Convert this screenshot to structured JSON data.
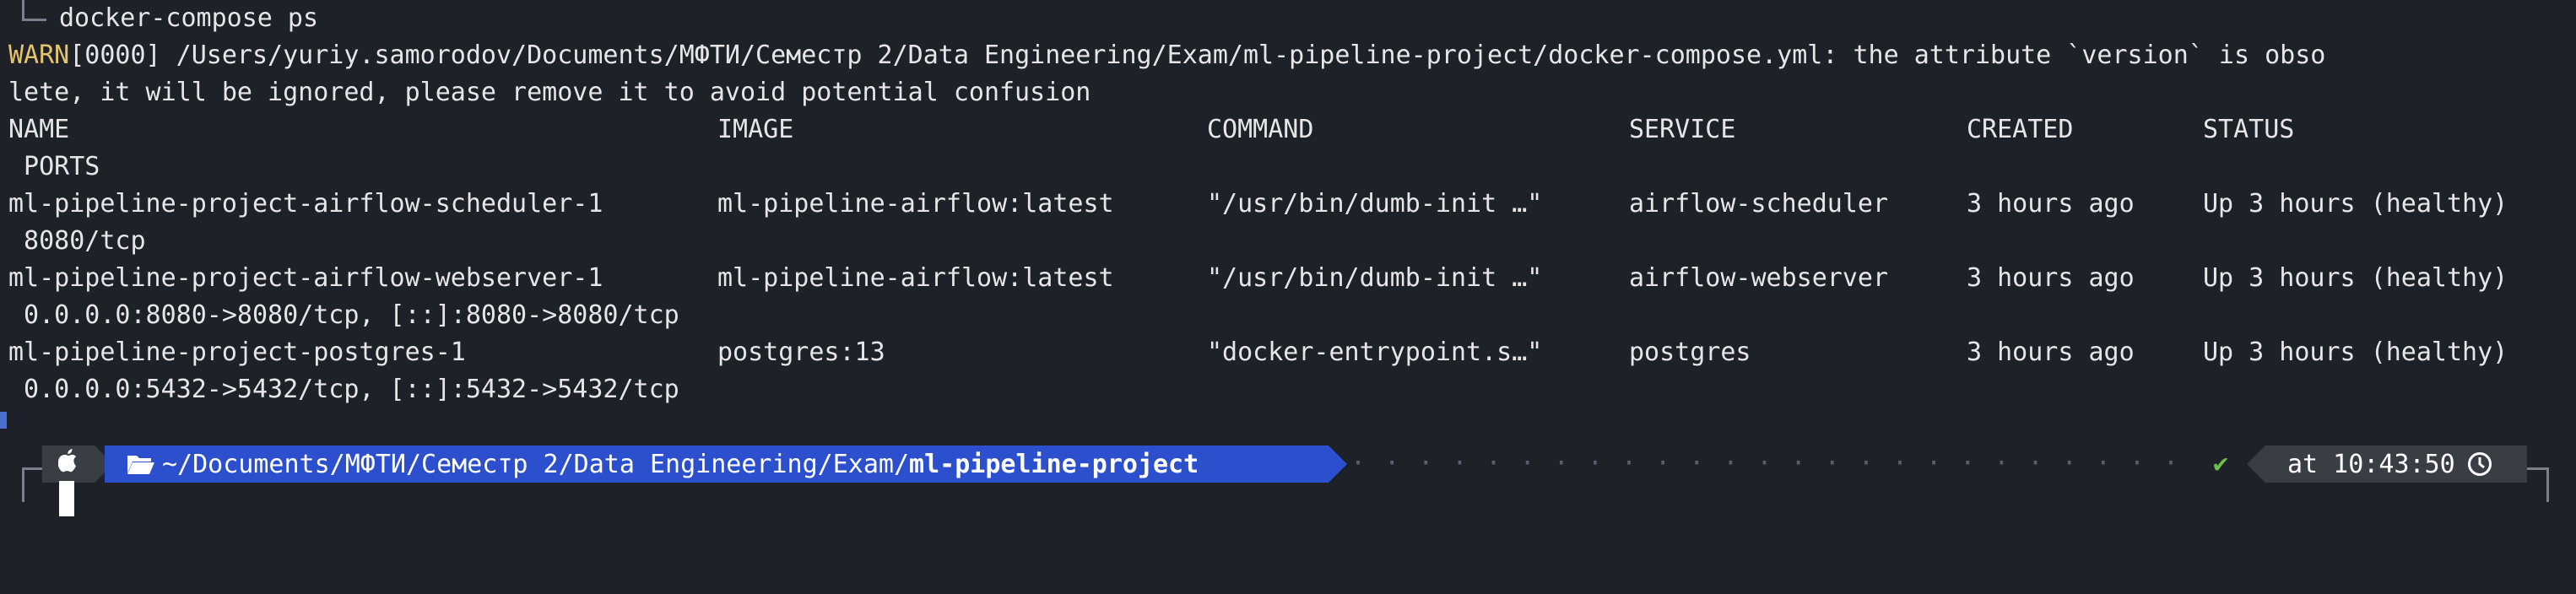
{
  "command_line": "docker-compose ps",
  "warn_prefix": "WARN",
  "warn_rest": "[0000] /Users/yuriy.samorodov/Documents/МФТИ/Семестр 2/Data Engineering/Exam/ml-pipeline-project/docker-compose.yml: the attribute `version` is obso",
  "warn_cont": "lete, it will be ignored, please remove it to avoid potential confusion",
  "headers": {
    "name": "NAME",
    "image": "IMAGE",
    "command": "COMMAND",
    "service": "SERVICE",
    "created": "CREATED",
    "status": "STATUS",
    "ports": " PORTS"
  },
  "rows": [
    {
      "name": "ml-pipeline-project-airflow-scheduler-1",
      "image": "ml-pipeline-airflow:latest",
      "command": "\"/usr/bin/dumb-init …\"",
      "service": "airflow-scheduler",
      "created": "3 hours ago",
      "status": "Up 3 hours (healthy)",
      "ports": " 8080/tcp"
    },
    {
      "name": "ml-pipeline-project-airflow-webserver-1",
      "image": "ml-pipeline-airflow:latest",
      "command": "\"/usr/bin/dumb-init …\"",
      "service": "airflow-webserver",
      "created": "3 hours ago",
      "status": "Up 3 hours (healthy)",
      "ports": " 0.0.0.0:8080->8080/tcp, [::]:8080->8080/tcp"
    },
    {
      "name": "ml-pipeline-project-postgres-1",
      "image": "postgres:13",
      "command": "\"docker-entrypoint.s…\"",
      "service": "postgres",
      "created": "3 hours ago",
      "status": "Up 3 hours (healthy)",
      "ports": " 0.0.0.0:5432->5432/tcp, [::]:5432->5432/tcp"
    }
  ],
  "prompt": {
    "os_icon": "apple-icon",
    "folder_icon": "folder-open-icon",
    "path_prefix": "~/Documents/МФТИ/Семестр 2/Data Engineering/Exam/",
    "path_bold": "ml-pipeline-project",
    "dots": "· · · · · · · · · · · · · · · · · · · · · · · · · · · · · · · · · · · · · · · · · · · · · · · · · ·",
    "status_mark": "✔",
    "time_text": "at 10:43:50",
    "clock_icon": "clock-icon"
  },
  "colors": {
    "background": "#1f2128",
    "warn": "#e5c56c",
    "path_segment": "#2c4fce",
    "segment_dark": "#3a3d44",
    "check": "#6ac04a"
  }
}
